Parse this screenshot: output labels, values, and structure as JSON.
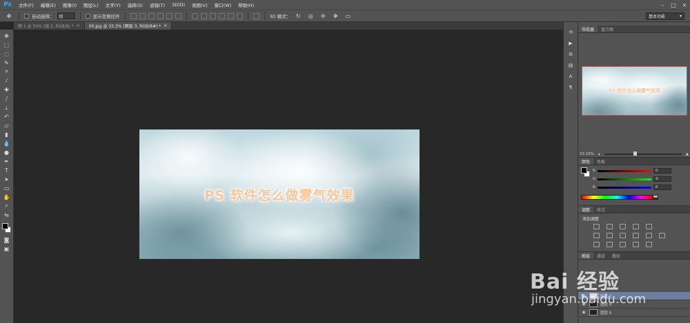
{
  "app": {
    "logo": "Ps"
  },
  "menu": [
    "文件(F)",
    "编辑(E)",
    "图像(I)",
    "图层(L)",
    "文字(Y)",
    "选择(S)",
    "滤镜(T)",
    "3D(D)",
    "视图(V)",
    "窗口(W)",
    "帮助(H)"
  ],
  "window_controls": {
    "minimize": "–",
    "maximize": "□",
    "close": "×"
  },
  "options": {
    "auto_select_label": "自动选择：",
    "auto_select_value": "组",
    "show_transform_label": "显示变换控件",
    "mode_3d_label": "3D 模式：",
    "workspace": "基本功能"
  },
  "tabs": [
    {
      "label": "图 1 @ 50% (组 2, RGB/8) *",
      "close": "×"
    },
    {
      "label": "00.jpg @ 33.3% (图层 3, RGB/8#) *",
      "close": "×"
    }
  ],
  "document": {
    "title_text": "PS 软件怎么做雾气效果"
  },
  "navigator": {
    "tabs": [
      "导航器",
      "直方图"
    ],
    "zoom": "33.33%"
  },
  "color": {
    "tabs": [
      "颜色",
      "色板"
    ],
    "channels": [
      {
        "label": "R",
        "value": "0"
      },
      {
        "label": "G",
        "value": "0"
      },
      {
        "label": "B",
        "value": "0"
      }
    ]
  },
  "adjustments": {
    "tabs": [
      "调整",
      "样式"
    ],
    "title": "添加调整"
  },
  "layers": {
    "tabs": [
      "图层",
      "通道",
      "路径"
    ],
    "rows": [
      {
        "name": "图层 3",
        "selected": true
      },
      {
        "name": "图层 9",
        "selected": false
      },
      {
        "name": "图层 8",
        "selected": false
      }
    ]
  },
  "watermark": {
    "logo": "Bai 经验",
    "url": "jingyan.baidu.com"
  },
  "colors": {
    "accent": "#31a8ff",
    "nav_frame": "#e04444",
    "title_orange": "#f6c79a"
  }
}
